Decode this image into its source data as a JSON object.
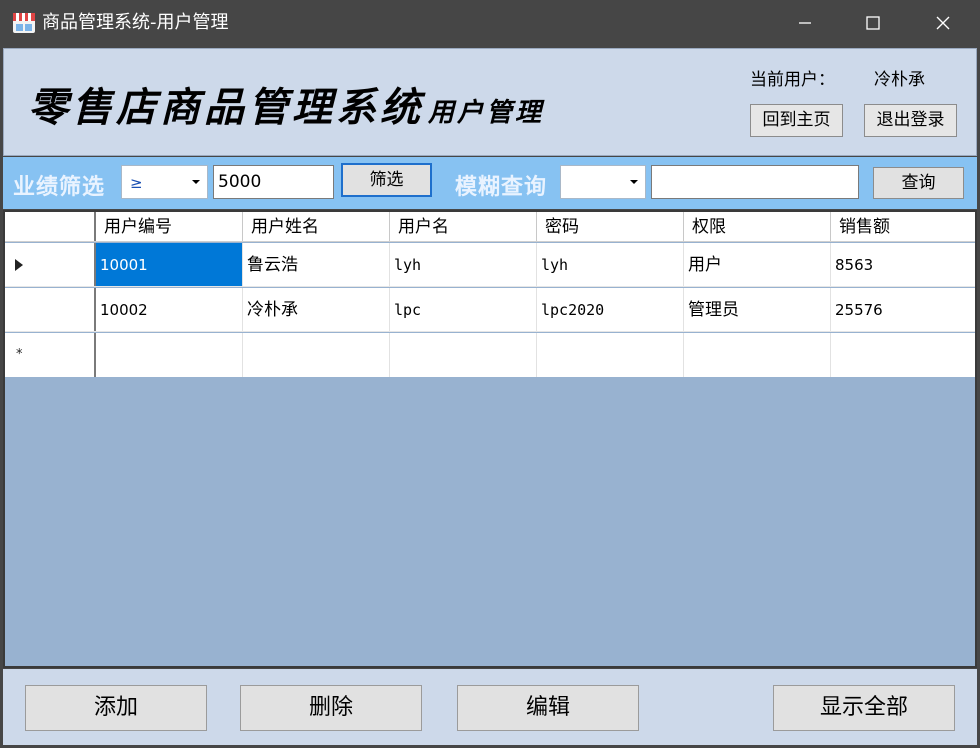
{
  "window": {
    "title": "商品管理系统-用户管理"
  },
  "header": {
    "brand_title": "零售店商品管理系统",
    "brand_subtitle": "用户管理",
    "current_user_label": "当前用户：",
    "current_user_name": "冷朴承",
    "home_button": "回到主页",
    "logout_button": "退出登录"
  },
  "filter": {
    "perf_label": "业绩筛选",
    "operator_value": "≥",
    "amount_value": "5000",
    "filter_button": "筛选",
    "fuzzy_label": "模糊查询",
    "field_value": "",
    "keyword_value": "",
    "query_button": "查询"
  },
  "table": {
    "columns": [
      "用户编号",
      "用户姓名",
      "用户名",
      "密码",
      "权限",
      "销售额"
    ],
    "rows": [
      [
        "10001",
        "鲁云浩",
        "lyh",
        "lyh",
        "用户",
        "8563"
      ],
      [
        "10002",
        "冷朴承",
        "lpc",
        "lpc2020",
        "管理员",
        "25576"
      ]
    ],
    "new_row_marker": "*"
  },
  "footer": {
    "add_button": "添加",
    "delete_button": "删除",
    "edit_button": "编辑",
    "show_all_button": "显示全部"
  },
  "colors": {
    "title_bar": "#464646",
    "header_bg": "#cdd9ea",
    "filter_bar": "#87c2f2",
    "grid_bg": "#98b2d0",
    "selection": "#0078d7"
  }
}
